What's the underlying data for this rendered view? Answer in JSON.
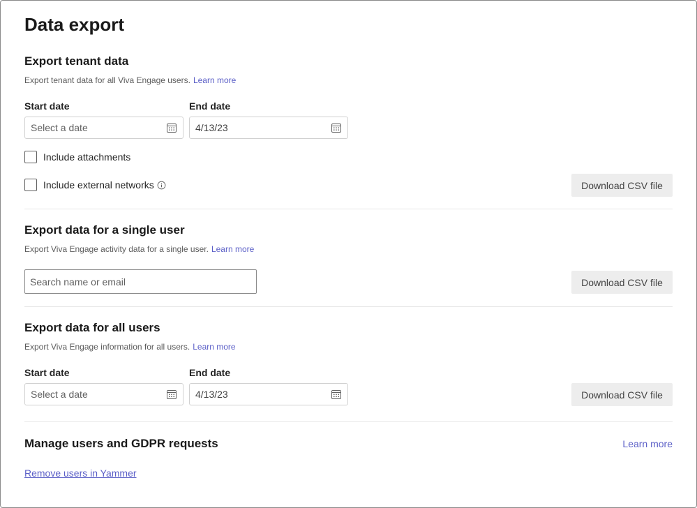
{
  "page": {
    "title": "Data export"
  },
  "tenant": {
    "title": "Export tenant data",
    "description": "Export tenant data for all Viva Engage users.",
    "learn_more": "Learn more",
    "start_label": "Start date",
    "start_placeholder": "Select a date",
    "end_label": "End date",
    "end_value": "4/13/23",
    "include_attachments": "Include attachments",
    "include_external": "Include external networks",
    "download_label": "Download CSV file"
  },
  "single_user": {
    "title": "Export data for a single user",
    "description": "Export Viva Engage activity data for a single user.",
    "learn_more": "Learn more",
    "search_placeholder": "Search name or email",
    "download_label": "Download CSV file"
  },
  "all_users": {
    "title": "Export data for all users",
    "description": "Export Viva Engage information for all users.",
    "learn_more": "Learn more",
    "start_label": "Start date",
    "start_placeholder": "Select a date",
    "end_label": "End date",
    "end_value": "4/13/23",
    "download_label": "Download CSV file"
  },
  "gdpr": {
    "title": "Manage users and GDPR requests",
    "learn_more": "Learn more",
    "remove_link": "Remove users in Yammer"
  },
  "icons": {
    "calendar": "calendar-icon",
    "info": "info-icon"
  },
  "colors": {
    "link": "#5b5fc7",
    "button_bg": "#ededed",
    "divider": "#e6e6e6"
  }
}
